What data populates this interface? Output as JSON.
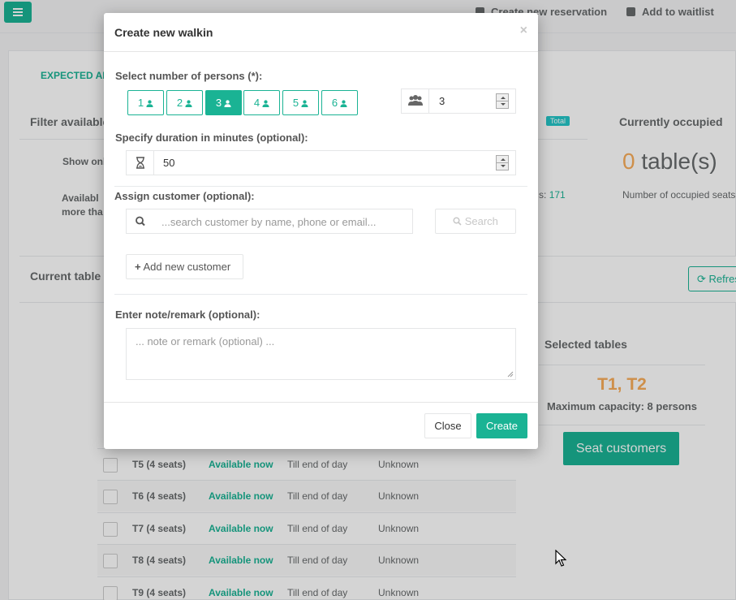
{
  "topbar": {
    "create_reservation": "Create new reservation",
    "add_to_waitlist": "Add to waitlist"
  },
  "background": {
    "expected_tab": "EXPECTED AR",
    "filter_title": "Filter available",
    "total_badge": "Total",
    "occupied_title": "Currently occupied",
    "show_only": "Show onl",
    "available_label": "Availabl more tha",
    "seats_label": "s:",
    "seats_value": "171",
    "occupied_zero": "0",
    "occupied_unit": "table(s)",
    "occupied_sub": "Number of occupied seats",
    "current_tables": "Current table",
    "refresh": "Refres",
    "selected_title": "Selected tables",
    "selected_tables": "T1, T2",
    "max_capacity": "Maximum capacity: 8 persons",
    "seat_customers": "Seat customers",
    "rows": [
      {
        "name": "T5 (4 seats)",
        "status": "Available now",
        "until": "Till end of day",
        "customer": "Unknown"
      },
      {
        "name": "T6 (4 seats)",
        "status": "Available now",
        "until": "Till end of day",
        "customer": "Unknown"
      },
      {
        "name": "T7 (4 seats)",
        "status": "Available now",
        "until": "Till end of day",
        "customer": "Unknown"
      },
      {
        "name": "T8 (4 seats)",
        "status": "Available now",
        "until": "Till end of day",
        "customer": "Unknown"
      },
      {
        "name": "T9 (4 seats)",
        "status": "Available now",
        "until": "Till end of day",
        "customer": "Unknown"
      }
    ]
  },
  "modal": {
    "title": "Create new walkin",
    "close_x": "×",
    "persons_label": "Select number of persons (*):",
    "persons": [
      "1",
      "2",
      "3",
      "4",
      "5",
      "6"
    ],
    "selected_persons": "3",
    "persons_value": "3",
    "duration_label": "Specify duration in minutes (optional):",
    "duration_value": "50",
    "customer_label": "Assign customer (optional):",
    "search_placeholder": "...search customer by name, phone or email...",
    "search_button": "Search",
    "add_customer": "Add new customer",
    "note_label": "Enter note/remark (optional):",
    "note_placeholder": "... note or remark (optional) ...",
    "close_button": "Close",
    "create_button": "Create"
  },
  "colors": {
    "accent": "#1ab394",
    "warning": "#f8ac59",
    "info": "#23c6c8"
  }
}
